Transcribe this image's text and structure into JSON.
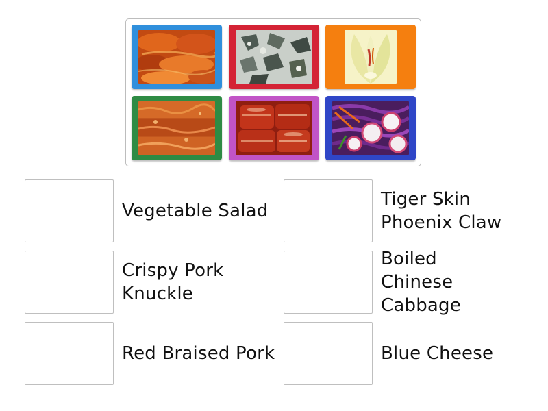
{
  "bank": {
    "tiles": [
      {
        "icon": "fried-pork-strips-image",
        "border_color": "#2f8fdc"
      },
      {
        "icon": "blue-cheese-image",
        "border_color": "#d42335"
      },
      {
        "icon": "boiled-chinese-cabbage-image",
        "border_color": "#f57f0f"
      },
      {
        "icon": "crispy-pork-knuckle-image",
        "border_color": "#2e8b44"
      },
      {
        "icon": "red-braised-pork-image",
        "border_color": "#c154c6"
      },
      {
        "icon": "vegetable-salad-image",
        "border_color": "#2f46c7"
      }
    ]
  },
  "targets": [
    {
      "label": "Vegetable Salad"
    },
    {
      "label": "Tiger Skin Phoenix Claw"
    },
    {
      "label": "Crispy Pork Knuckle"
    },
    {
      "label": "Boiled Chinese Cabbage"
    },
    {
      "label": "Red Braised Pork"
    },
    {
      "label": "Blue Cheese"
    }
  ]
}
